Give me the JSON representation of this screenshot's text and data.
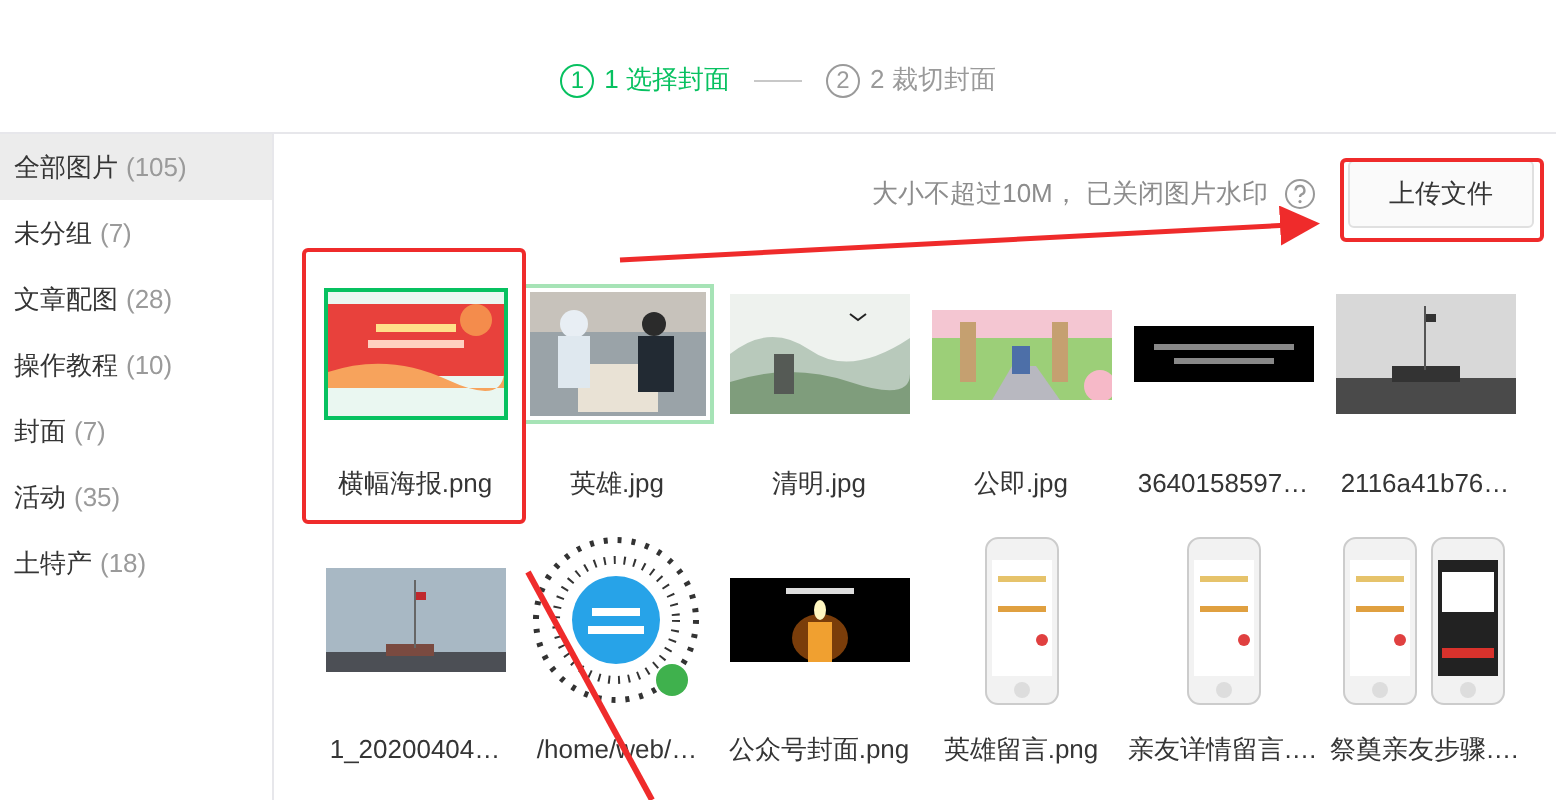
{
  "steps": [
    {
      "number": "1",
      "label": "1 选择封面",
      "selected": true
    },
    {
      "number": "2",
      "label": "2 裁切封面",
      "selected": false
    }
  ],
  "sidebar": {
    "items": [
      {
        "label": "全部图片",
        "count": "(105)",
        "selected": true
      },
      {
        "label": "未分组",
        "count": "(7)",
        "selected": false
      },
      {
        "label": "文章配图",
        "count": "(28)",
        "selected": false
      },
      {
        "label": "操作教程",
        "count": "(10)",
        "selected": false
      },
      {
        "label": "封面",
        "count": "(7)",
        "selected": false
      },
      {
        "label": "活动",
        "count": "(35)",
        "selected": false
      },
      {
        "label": "土特产",
        "count": "(18)",
        "selected": false
      }
    ]
  },
  "toolbar": {
    "hint": "大小不超过10M， 已关闭图片水印",
    "upload_button": "上传文件"
  },
  "images": [
    {
      "name": "横幅海报.png",
      "selected": true,
      "hovered": false
    },
    {
      "name": "英雄.jpg",
      "selected": false,
      "hovered": true
    },
    {
      "name": "清明.jpg",
      "selected": false,
      "hovered": false
    },
    {
      "name": "公即.jpg",
      "selected": false,
      "hovered": false
    },
    {
      "name": "3640158597…",
      "selected": false,
      "hovered": false
    },
    {
      "name": "2116a41b76…",
      "selected": false,
      "hovered": false
    },
    {
      "name": "1_20200404…",
      "selected": false,
      "hovered": false
    },
    {
      "name": "/home/web/…",
      "selected": false,
      "hovered": false
    },
    {
      "name": "公众号封面.png",
      "selected": false,
      "hovered": false
    },
    {
      "name": "英雄留言.png",
      "selected": false,
      "hovered": false
    },
    {
      "name": "亲友详情留言.…",
      "selected": false,
      "hovered": false
    },
    {
      "name": "祭奠亲友步骤.…",
      "selected": false,
      "hovered": false
    }
  ]
}
